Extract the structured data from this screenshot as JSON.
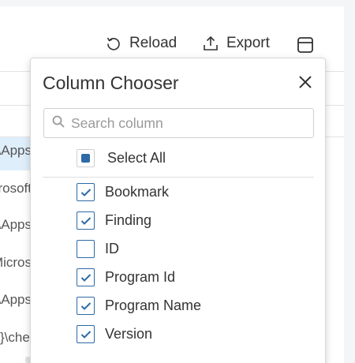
{
  "toolbar": {
    "reload_label": "Reload",
    "export_label": "Export"
  },
  "grid": {
    "cells": [
      "Apps\\",
      "rosoft\\",
      "Apps\\",
      "Micros",
      "Apps\\",
      "che\\{"
    ]
  },
  "column_chooser": {
    "title": "Column Chooser",
    "search": {
      "placeholder": "Search column",
      "value": ""
    },
    "select_all": {
      "label": "Select All",
      "state": "indeterminate"
    },
    "options": [
      {
        "label": "Bookmark",
        "checked": true
      },
      {
        "label": "Finding",
        "checked": true
      },
      {
        "label": "ID",
        "checked": false
      },
      {
        "label": "Program Id",
        "checked": true
      },
      {
        "label": "Program Name",
        "checked": true
      },
      {
        "label": "Version",
        "checked": true
      }
    ]
  },
  "colors": {
    "accent": "#2e6aa6",
    "row_highlight": "#dfeefb"
  }
}
